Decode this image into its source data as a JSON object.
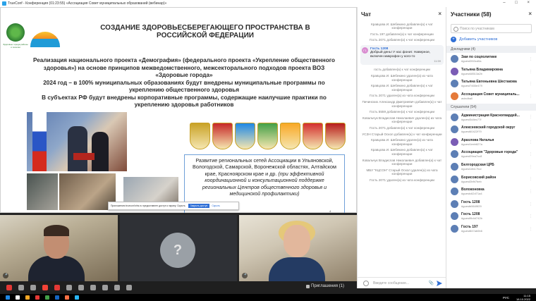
{
  "window": {
    "title": "TrueConf - Конференция (01:23:55) «Ассоциация Совет муниципальных образований (вебинар)»",
    "controls": "– □ ×"
  },
  "slide": {
    "title": "СОЗДАНИЕ ЗДОРОВЬЕСБЕРЕГАЮЩЕГО ПРОСТРАНСТВА В РОССИЙСКОЙ ФЕДЕРАЦИИ",
    "body_lines": [
      "Реализация национального проекта «Демография» (федерального проекта «Укрепление общественного здоровья») на основе принципов межведомственного, межсекторального подходов проекта ВОЗ «Здоровые города»",
      "2024 год – в 100% муниципальных образованиях будут внедрены муниципальные программы по укреплению общественного здоровья",
      "В субъектах РФ будут внедрены корпоративные программы, содержащие наилучшие практики по укреплению здоровья работников"
    ],
    "logo_caption": "Здоровые города районы и поселки",
    "regions_text": "Развитие региональных сетей Ассоциации в Ульяновской, Вологодской, Самарской, Воронежской областях, Алтайском крае, Красноярском крае и др.",
    "regions_italic": "(при эффективной координационной и консультационной поддержке региональных Центров общественного здоровья и медицинской профилактики)",
    "page_marker": "4",
    "crest_colors": [
      "#c9a227",
      "#c62828",
      "#1e88e5",
      "#43a047",
      "#f9a825",
      "#d32f2f",
      "#b71c1c"
    ],
    "notice": {
      "text": "Приложению trueconf.ebs.ru предоставлен доступ к экрану. Скрыть",
      "primary": "Закрыть доступ",
      "secondary": "Скрыть"
    }
  },
  "videos": {
    "avatar_glyph": "?",
    "mic_glyph": "🎤"
  },
  "toolbar": {
    "invites_label": "Приглашения (1)",
    "icon_colors": [
      "#e53935",
      "#9e9e9e",
      "#9e9e9e",
      "#f44336",
      "#e53935",
      "#9e9e9e",
      "#9e9e9e",
      "#9e9e9e",
      "#9e9e9e",
      "#9e9e9e",
      "#9e9e9e"
    ]
  },
  "chat": {
    "title": "Чат",
    "close": "×",
    "messages_top": [
      "Кравцова И. Шебекино добавлен(а) к чат конференции",
      "Гость 197 добавлен(а) к чат конференции",
      "Гость 2071 добавлен(а) к чат конференции"
    ],
    "bubble": {
      "avatar": "Г1",
      "name": "Гость 1208",
      "text": "Добрый день! У нас фонит. Наверное, включен микрофон у кого-то",
      "time": "11:59"
    },
    "messages_bottom": [
      "гость добавлен(а) к чат конференции",
      "Кравцова И. Шебекино удален(а) из чата конференции",
      "Кравцова И. Шебекино добавлен(а) к чат конференции",
      "Гость 2071 удален(а) из чата конференции",
      "Пичинских Александр Дмитриевич добавлен(а) к чат конференции",
      "Гость 5559 добавлен(а) к чат конференции",
      "Ковальчук Владислав Николаевич удален(а) из чата конференции",
      "Гость 2071 добавлен(а) к чат конференции",
      "УСЗН Старый Оскол добавлен(а) к чат конференции",
      "Кравцова И. Шебекино удален(а) из чата конференции",
      "Кравцова И. Шебекино добавлен(а) к чат конференции",
      "Ковальчук Владислав Николаевич добавлен(а) к чат конференции",
      "МБУ \"КЦСОН\" Старый Оскол удален(а) из чата конференции",
      "Гость 2071 удален(а) из чата конференции"
    ],
    "input_placeholder": "Введите сообщение..."
  },
  "participants": {
    "title": "Участники (58)",
    "close": "×",
    "search_placeholder": "Поиск по участникам",
    "add_label": "Добавить участников",
    "speakers_label": "Докладчики (4)",
    "speakers": [
      {
        "name": "Зам по соцполитике",
        "id": "#guest2f40cd0a",
        "color": "#5d7fb5"
      },
      {
        "name": "Татьяна Владимировна",
        "id": "#guest48513a2b",
        "color": "#7b5db5"
      },
      {
        "name": "Татьяна Евгеньевна Шестакова",
        "id": "#guest7465e479",
        "color": "#5d7fb5"
      },
      {
        "name": "Ассоциация Совет муниципаль...",
        "id": "avindball",
        "color": "#e57a3a"
      }
    ],
    "listeners_label": "Слушатели (54)",
    "listeners": [
      {
        "name": "Администрация Красногвардей...",
        "id": "#guest3d4ec77f",
        "color": "#5d7fb5"
      },
      {
        "name": "Алексеевский городской округ",
        "id": "#guest60422f79",
        "color": "#5d7fb5"
      },
      {
        "name": "Арахлова Наталья",
        "id": "#guest1eeb827a",
        "color": "#7b5db5"
      },
      {
        "name": "Ассоциация \"Здоровые города\"",
        "id": "#guest29ea7cc8",
        "color": "#5d7fb5"
      },
      {
        "name": "Белгородская ЦРБ",
        "id": "#guest18b17fcd",
        "color": "#5d7fb5"
      },
      {
        "name": "Борисовский район",
        "id": "#guest2bfb7beb",
        "color": "#5d7fb5"
      },
      {
        "name": "Волоконовка",
        "id": "#guestc62d71a4",
        "color": "#5d7fb5"
      },
      {
        "name": "Гость 1208",
        "id": "#guestb5649f29",
        "color": "#5d7fb5"
      },
      {
        "name": "Гость 1208",
        "id": "#guest9b4d742b",
        "color": "#5d7fb5"
      },
      {
        "name": "Гость 197",
        "id": "#guest847ab0b6",
        "color": "#5d7fb5"
      }
    ],
    "more_glyph": "⋮"
  },
  "taskbar": {
    "lang": "РУС",
    "time": "11:15",
    "date": "18.10.2022",
    "icon_colors": [
      "#1e88e5",
      "#ffffff",
      "#f9a825",
      "#e53935",
      "#43a047",
      "#1565c0",
      "#ff7043",
      "#29b6f6"
    ]
  }
}
